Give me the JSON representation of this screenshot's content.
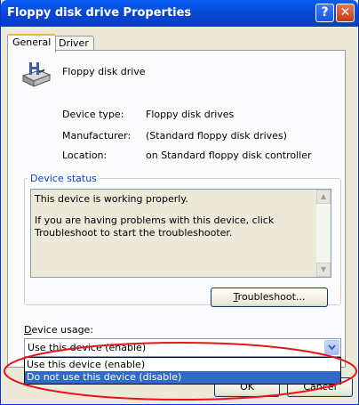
{
  "window": {
    "title": "Floppy disk drive Properties",
    "help_glyph": "?",
    "close_glyph": "✕"
  },
  "tabs": [
    {
      "label": "General",
      "active": true
    },
    {
      "label": "Driver",
      "active": false
    }
  ],
  "device": {
    "name": "Floppy disk drive",
    "icon": "floppy-drive-icon"
  },
  "properties": [
    {
      "label": "Device type:",
      "value": "Floppy disk drives"
    },
    {
      "label": "Manufacturer:",
      "value": "(Standard floppy disk drives)"
    },
    {
      "label": "Location:",
      "value": "on Standard floppy disk controller"
    }
  ],
  "status": {
    "group_title": "Device status",
    "line1": "This device is working properly.",
    "line2": "If you are having problems with this device, click Troubleshoot to start the troubleshooter."
  },
  "troubleshoot": {
    "mnemonic": "T",
    "rest": "roubleshoot..."
  },
  "usage": {
    "label_mnemonic": "D",
    "label_rest": "evice usage:",
    "selected": "Use this device (enable)",
    "options": [
      "Use this device (enable)",
      "Do not use this device (disable)"
    ],
    "highlighted_index": 1
  },
  "buttons": {
    "ok": "OK",
    "cancel": "Cancel"
  },
  "colors": {
    "accent": "#316ac5",
    "annotation": "#e8141a",
    "title_bar": "#0a5ef5"
  }
}
